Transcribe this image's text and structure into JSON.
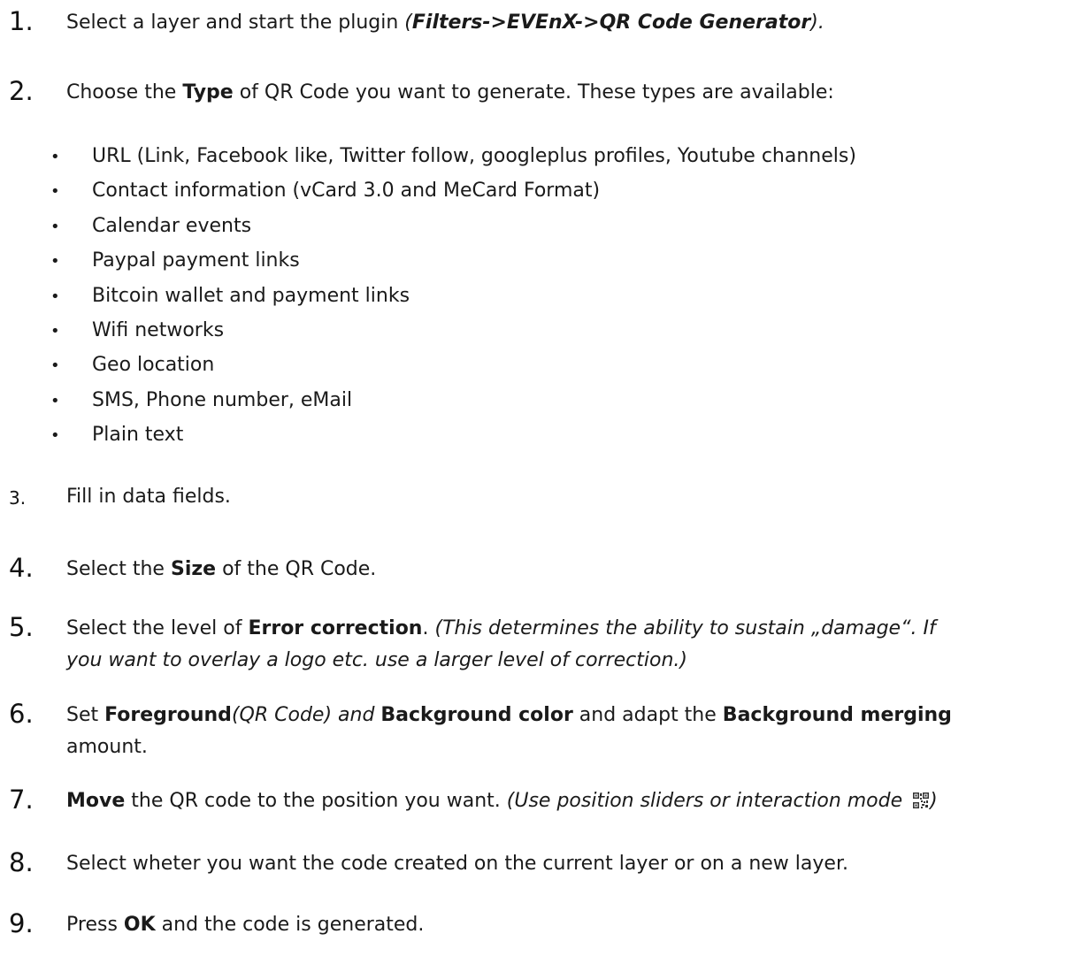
{
  "steps": [
    {
      "num": "1.",
      "parts": [
        {
          "t": "Select a layer and start the plugin ",
          "s": ""
        },
        {
          "t": "(",
          "s": "i"
        },
        {
          "t": "Filters->EVEnX->QR Code Generator",
          "s": "bi"
        },
        {
          "t": ").",
          "s": "i"
        }
      ]
    },
    {
      "num": "2.",
      "parts": [
        {
          "t": "Choose the ",
          "s": ""
        },
        {
          "t": "Type",
          "s": "b"
        },
        {
          "t": " of QR Code you want to generate. These types are available:",
          "s": ""
        }
      ]
    },
    {
      "num": "3.",
      "parts": [
        {
          "t": "Fill in data fields.",
          "s": ""
        }
      ]
    },
    {
      "num": "4.",
      "parts": [
        {
          "t": "Select the ",
          "s": ""
        },
        {
          "t": "Size",
          "s": "b"
        },
        {
          "t": " of the QR Code.",
          "s": ""
        }
      ]
    },
    {
      "num": "5.",
      "parts": [
        {
          "t": "Select the level of ",
          "s": ""
        },
        {
          "t": "Error correction",
          "s": "b"
        },
        {
          "t": ". ",
          "s": ""
        },
        {
          "t": "(This determines the ability to sustain „damage“. If",
          "s": "i"
        }
      ],
      "cont": [
        {
          "t": "you want to overlay a logo etc. use a larger level of correction.)",
          "s": "i"
        }
      ]
    },
    {
      "num": "6.",
      "parts": [
        {
          "t": "Set ",
          "s": ""
        },
        {
          "t": "Foreground",
          "s": "b"
        },
        {
          "t": "(QR Code) and ",
          "s": "i"
        },
        {
          "t": "Background color",
          "s": "b"
        },
        {
          "t": " and adapt the ",
          "s": ""
        },
        {
          "t": "Background merging",
          "s": "b"
        }
      ],
      "cont": [
        {
          "t": "amount.",
          "s": ""
        }
      ]
    },
    {
      "num": "7.",
      "parts": [
        {
          "t": "Move",
          "s": "b"
        },
        {
          "t": " the QR code to the position you want. ",
          "s": ""
        },
        {
          "t": "(Use position sliders or interaction mode ",
          "s": "i"
        }
      ],
      "icon": "qr-code-icon",
      "after": [
        {
          "t": ")",
          "s": "i"
        }
      ]
    },
    {
      "num": "8.",
      "parts": [
        {
          "t": "Select wheter you want the code created on the current layer or on a new layer.",
          "s": ""
        }
      ]
    },
    {
      "num": "9.",
      "parts": [
        {
          "t": "Press ",
          "s": ""
        },
        {
          "t": "OK",
          "s": "b"
        },
        {
          "t": " and the code is generated.",
          "s": ""
        }
      ]
    }
  ],
  "bullet_glyph": "•",
  "types": [
    "URL (Link, Facebook like, Twitter follow, googleplus profiles, Youtube channels)",
    "Contact information (vCard 3.0 and MeCard Format)",
    "Calendar events",
    "Paypal payment links",
    "Bitcoin wallet and payment links",
    "Wifi networks",
    "Geo location",
    "SMS, Phone number, eMail",
    "Plain text"
  ]
}
